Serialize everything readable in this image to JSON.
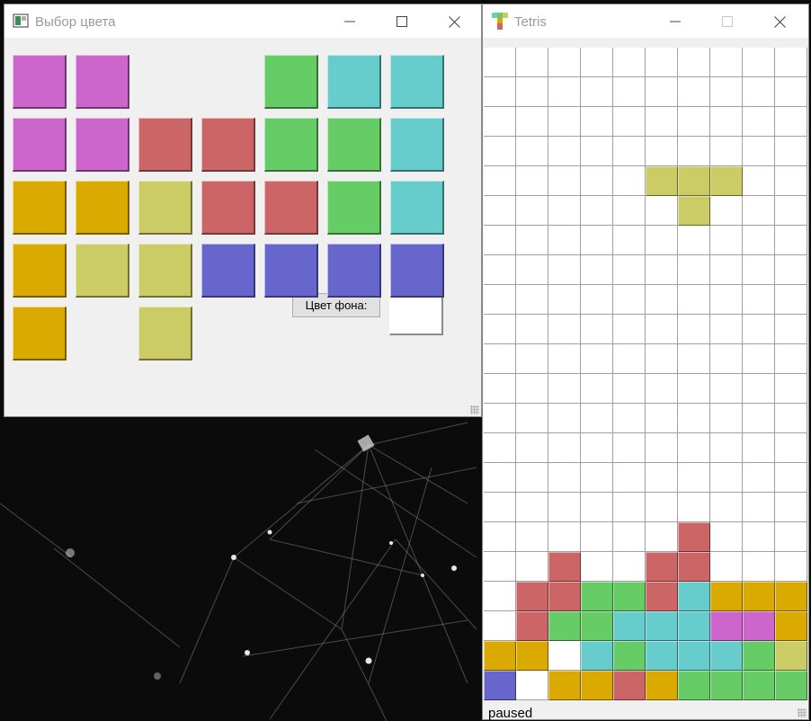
{
  "colors": {
    "magenta": "#cc66cc",
    "green": "#66cc66",
    "cyan": "#66cccc",
    "red": "#cc6666",
    "orange": "#daaa00",
    "yellow": "#cccc66",
    "blue": "#6666cc"
  },
  "color_dialog": {
    "title": "Выбор цвета",
    "swatch_rows": [
      [
        "magenta",
        "magenta",
        null,
        null,
        "green",
        "cyan",
        "cyan"
      ],
      [
        "magenta",
        "magenta",
        "red",
        "red",
        "green",
        "green",
        "cyan"
      ],
      [
        "orange",
        "orange",
        "yellow",
        "red",
        "red",
        "green",
        "cyan"
      ],
      [
        "orange",
        "yellow",
        "yellow",
        "blue",
        "blue",
        "blue",
        "blue"
      ],
      [
        "orange",
        null,
        "yellow",
        null,
        null,
        null,
        null
      ]
    ],
    "background_label": "Цвет фона:",
    "background_color": "#ffffff"
  },
  "tetris": {
    "title": "Tetris",
    "status": "paused",
    "board": [
      [
        "",
        "",
        "",
        "",
        "",
        "",
        "",
        "",
        "",
        ""
      ],
      [
        "",
        "",
        "",
        "",
        "",
        "",
        "",
        "",
        "",
        ""
      ],
      [
        "",
        "",
        "",
        "",
        "",
        "",
        "",
        "",
        "",
        ""
      ],
      [
        "",
        "",
        "",
        "",
        "",
        "",
        "",
        "",
        "",
        ""
      ],
      [
        "",
        "",
        "",
        "",
        "",
        "yellow",
        "yellow",
        "yellow",
        "",
        ""
      ],
      [
        "",
        "",
        "",
        "",
        "",
        "",
        "yellow",
        "",
        "",
        ""
      ],
      [
        "",
        "",
        "",
        "",
        "",
        "",
        "",
        "",
        "",
        ""
      ],
      [
        "",
        "",
        "",
        "",
        "",
        "",
        "",
        "",
        "",
        ""
      ],
      [
        "",
        "",
        "",
        "",
        "",
        "",
        "",
        "",
        "",
        ""
      ],
      [
        "",
        "",
        "",
        "",
        "",
        "",
        "",
        "",
        "",
        ""
      ],
      [
        "",
        "",
        "",
        "",
        "",
        "",
        "",
        "",
        "",
        ""
      ],
      [
        "",
        "",
        "",
        "",
        "",
        "",
        "",
        "",
        "",
        ""
      ],
      [
        "",
        "",
        "",
        "",
        "",
        "",
        "",
        "",
        "",
        ""
      ],
      [
        "",
        "",
        "",
        "",
        "",
        "",
        "",
        "",
        "",
        ""
      ],
      [
        "",
        "",
        "",
        "",
        "",
        "",
        "",
        "",
        "",
        ""
      ],
      [
        "",
        "",
        "",
        "",
        "",
        "",
        "",
        "",
        "",
        ""
      ],
      [
        "",
        "",
        "",
        "",
        "",
        "",
        "red",
        "",
        "",
        ""
      ],
      [
        "",
        "",
        "red",
        "",
        "",
        "red",
        "red",
        "",
        "",
        ""
      ],
      [
        "",
        "red",
        "red",
        "green",
        "green",
        "red",
        "cyan",
        "orange",
        "orange",
        "orange"
      ],
      [
        "",
        "red",
        "green",
        "green",
        "cyan",
        "cyan",
        "cyan",
        "magenta",
        "magenta",
        "orange"
      ],
      [
        "orange",
        "orange",
        "",
        "cyan",
        "green",
        "cyan",
        "cyan",
        "cyan",
        "green",
        "yellow"
      ],
      [
        "blue",
        "",
        "orange",
        "orange",
        "red",
        "orange",
        "green",
        "green",
        "green",
        "green"
      ]
    ]
  }
}
